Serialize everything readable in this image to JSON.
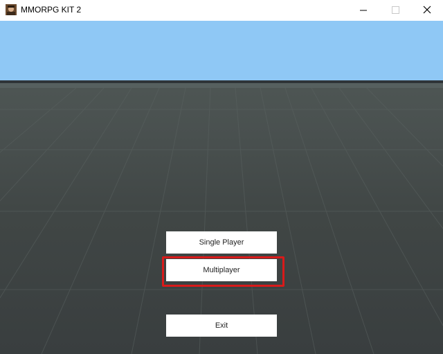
{
  "window": {
    "title": "MMORPG KIT 2",
    "app_icon": "game-app-icon",
    "controls": {
      "minimize_icon": "minimize-icon",
      "maximize_icon": "maximize-icon",
      "close_icon": "close-icon"
    }
  },
  "scene": {
    "sky_color": "#8fc8f5",
    "ground_color": "#404645"
  },
  "menu": {
    "single_player_label": "Single Player",
    "multiplayer_label": "Multiplayer",
    "exit_label": "Exit"
  },
  "annotation": {
    "highlight_color": "#d91a1a",
    "highlighted_item": "Multiplayer"
  }
}
